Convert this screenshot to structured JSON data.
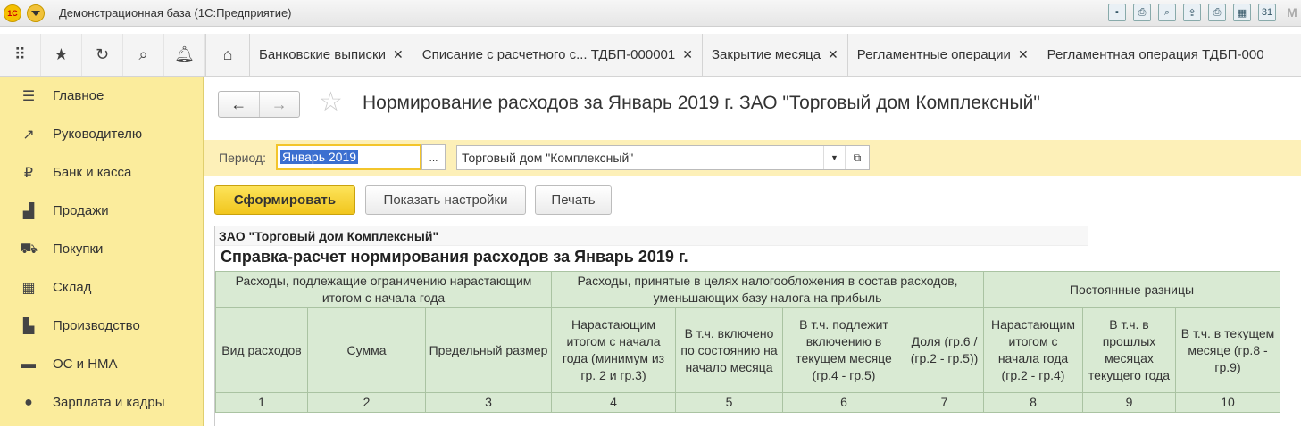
{
  "titlebar": {
    "logo": "1С",
    "window_title": "Демонстрационная база  (1С:Предприятие)",
    "icons": [
      "save-icon",
      "print-icon",
      "preview-icon",
      "export-icon",
      "printer-icon",
      "calculator-icon",
      "calendar-icon",
      "m-icon"
    ],
    "calendar_label": "31",
    "m_label": "M"
  },
  "tabs": [
    {
      "label": "Банковские выписки"
    },
    {
      "label": "Списание с расчетного с...  ТДБП-000001"
    },
    {
      "label": "Закрытие месяца"
    },
    {
      "label": "Регламентные операции"
    },
    {
      "label": "Регламентная операция ТДБП-000"
    }
  ],
  "sidebar": {
    "items": [
      {
        "label": "Главное",
        "icon": "menu-lines-icon"
      },
      {
        "label": "Руководителю",
        "icon": "trend-icon"
      },
      {
        "label": "Банк и касса",
        "icon": "ruble-icon"
      },
      {
        "label": "Продажи",
        "icon": "bag-icon"
      },
      {
        "label": "Покупки",
        "icon": "cart-icon"
      },
      {
        "label": "Склад",
        "icon": "warehouse-icon"
      },
      {
        "label": "Производство",
        "icon": "factory-icon"
      },
      {
        "label": "ОС и НМА",
        "icon": "truck-icon"
      },
      {
        "label": "Зарплата и кадры",
        "icon": "person-icon"
      }
    ]
  },
  "page": {
    "title": "Нормирование расходов за Январь 2019 г. ЗАО \"Торговый дом Комплексный\"",
    "period_label": "Период:",
    "period_value": "Январь 2019",
    "period_button": "...",
    "organization": "Торговый дом \"Комплексный\""
  },
  "buttons": {
    "generate": "Сформировать",
    "show_settings": "Показать настройки",
    "print": "Печать"
  },
  "report": {
    "org": "ЗАО \"Торговый дом Комплексный\"",
    "title": "Справка-расчет нормирования расходов за Январь 2019 г.",
    "group_headers": [
      "Расходы, подлежащие ограничению нарастающим итогом с начала года",
      "Расходы, принятые в целях налогообложения в состав расходов, уменьшающих базу налога на прибыль",
      "Постоянные разницы"
    ],
    "columns": [
      "Вид расходов",
      "Сумма",
      "Предельный размер",
      "Нарастающим итогом с начала года (минимум из гр. 2 и гр.3)",
      "В т.ч. включено по состоянию на начало месяца",
      "В т.ч. подлежит включению в текущем месяце (гр.4 - гр.5)",
      "Доля (гр.6 / (гр.2 - гр.5))",
      "Нарастающим итогом с начала года (гр.2 - гр.4)",
      "В т.ч. в прошлых месяцах текущего года",
      "В т.ч. в текущем месяце (гр.8 - гр.9)"
    ],
    "numbers": [
      "1",
      "2",
      "3",
      "4",
      "5",
      "6",
      "7",
      "8",
      "9",
      "10"
    ]
  }
}
